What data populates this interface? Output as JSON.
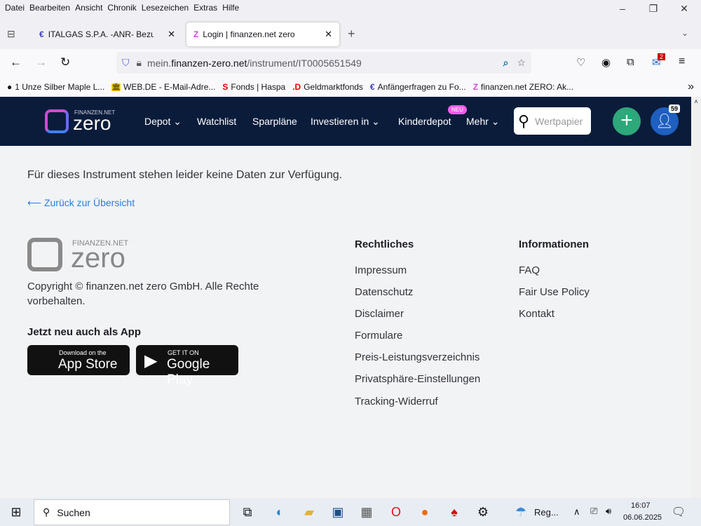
{
  "menu": [
    "Datei",
    "Bearbeiten",
    "Ansicht",
    "Chronik",
    "Lesezeichen",
    "Extras",
    "Hilfe"
  ],
  "tabs": [
    {
      "label": "ITALGAS S.P.A. -ANR- Bezugsrec"
    },
    {
      "label": "Login | finanzen.net zero"
    }
  ],
  "url": {
    "domain_pre": "mein.",
    "domain": "finanzen-zero.net",
    "path": "/instrument/IT0005651549"
  },
  "mail_badge": "2",
  "bookmarks": [
    "1 Unze Silber Maple L...",
    "WEB.DE - E-Mail-Adre...",
    "Fonds | Haspa",
    "Geldmarktfonds",
    "Anfängerfragen zu Fo...",
    "finanzen.net ZERO: Ak..."
  ],
  "header": {
    "logo_top": "FINANZEN.NET",
    "logo_main": "zero",
    "nav": [
      "Depot",
      "Watchlist",
      "Sparpläne",
      "Investieren in",
      "Kinderdepot",
      "Mehr"
    ],
    "new_badge": "NEU",
    "search_placeholder": "Wertpapier",
    "notif_count": "59"
  },
  "main": {
    "message": "Für dieses Instrument stehen leider keine Daten zur Verfügung.",
    "back_link": "⟵ Zurück zur Übersicht"
  },
  "footer": {
    "logo_top": "FINANZEN.NET",
    "logo_main": "zero",
    "copyright": "Copyright © finanzen.net zero GmbH. Alle Rechte vorbehalten.",
    "app_heading": "Jetzt neu auch als App",
    "appstore_small": "Download on the",
    "appstore_big": "App Store",
    "play_small": "GET IT ON",
    "play_big": "Google Play",
    "legal_heading": "Rechtliches",
    "legal": [
      "Impressum",
      "Datenschutz",
      "Disclaimer",
      "Formulare",
      "Preis-Leistungsverzeichnis",
      "Privatsphäre-Einstellungen",
      "Tracking-Widerruf"
    ],
    "info_heading": "Informationen",
    "info": [
      "FAQ",
      "Fair Use Policy",
      "Kontakt"
    ]
  },
  "taskbar": {
    "search": "Suchen",
    "weather": "Reg...",
    "time": "16:07",
    "date": "06.06.2025"
  },
  "colors": {
    "header_bg": "#0b1c3b",
    "link": "#2b7de0",
    "plus": "#2ea77a",
    "avatar": "#1f5fbf",
    "neu": "#f25ee8"
  }
}
